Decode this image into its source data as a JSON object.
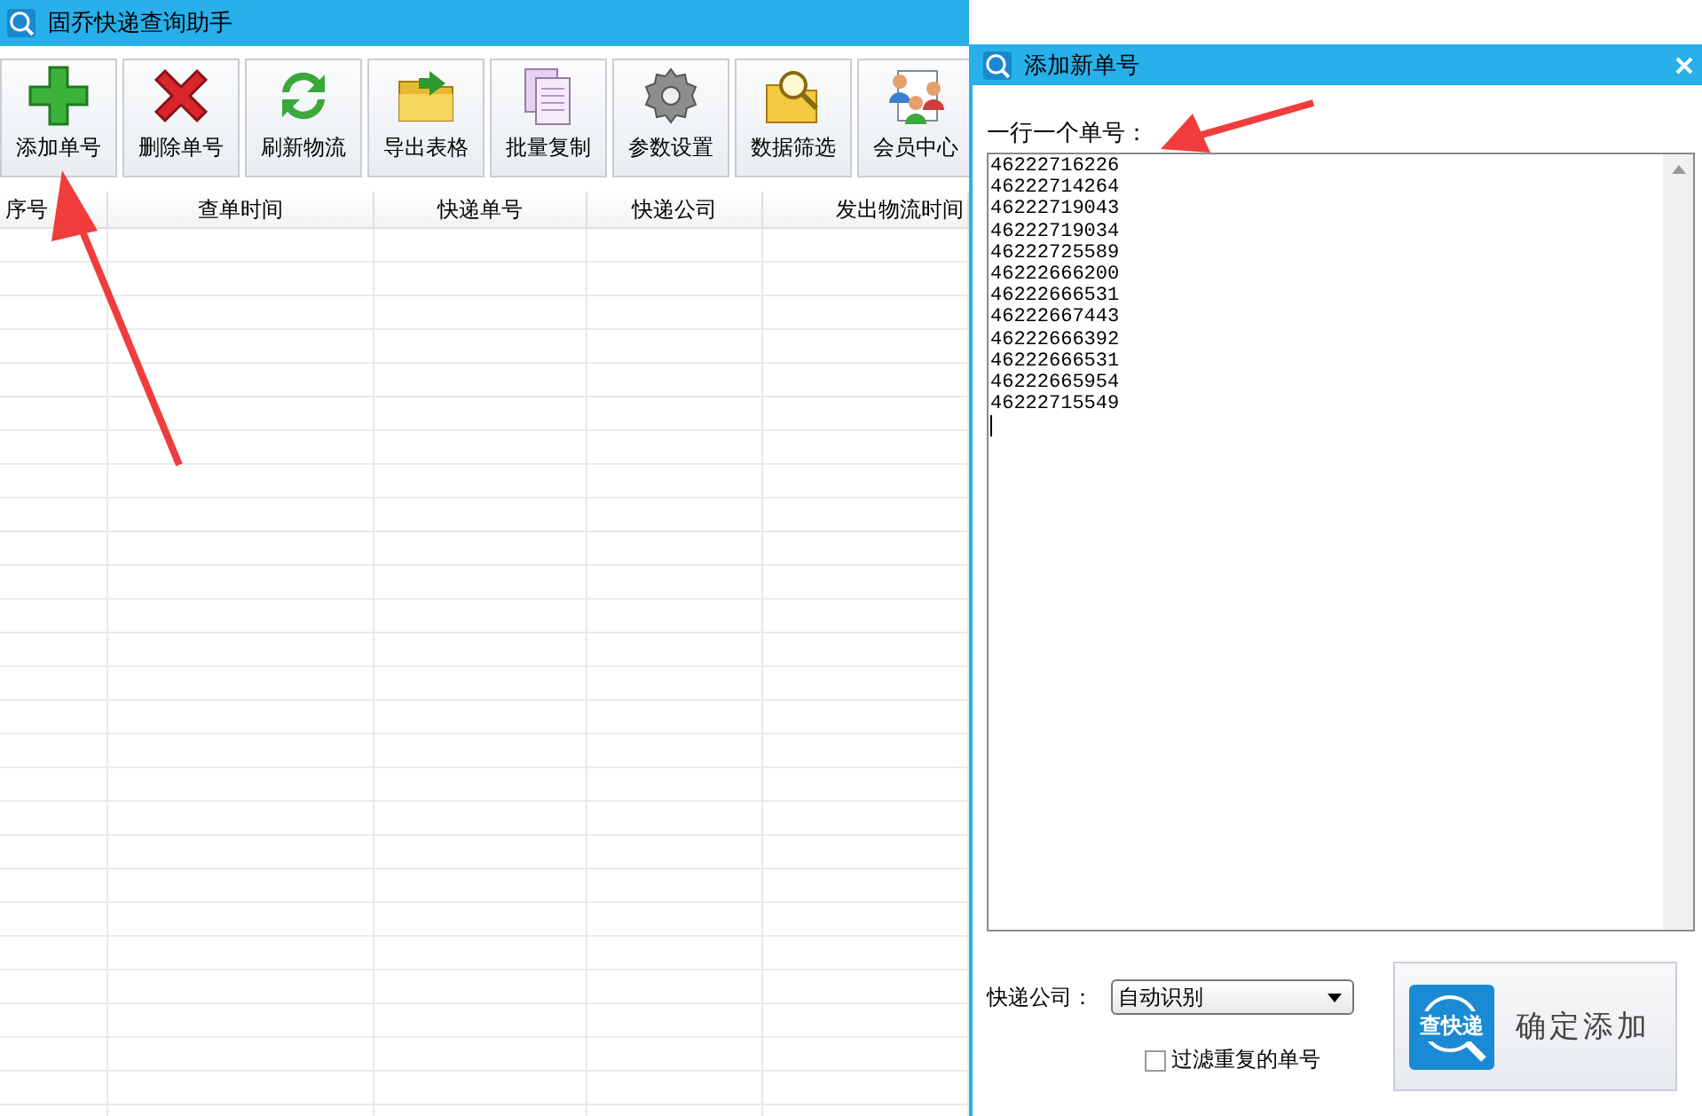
{
  "window": {
    "title": "固乔快递查询助手"
  },
  "toolbar": [
    {
      "label": "添加单号"
    },
    {
      "label": "删除单号"
    },
    {
      "label": "刷新物流"
    },
    {
      "label": "导出表格"
    },
    {
      "label": "批量复制"
    },
    {
      "label": "参数设置"
    },
    {
      "label": "数据筛选"
    },
    {
      "label": "会员中心"
    }
  ],
  "table": {
    "columns": [
      "序号",
      "查单时间",
      "快递单号",
      "快递公司",
      "发出物流时间"
    ]
  },
  "dialog": {
    "title": "添加新单号",
    "label": "一行一个单号：",
    "numbers": [
      "46222716226",
      "46222714264",
      "46222719043",
      "46222719034",
      "46222725589",
      "46222666200",
      "46222666531",
      "46222667443",
      "46222666392",
      "46222666531",
      "46222665954",
      "46222715549"
    ],
    "company_label": "快递公司：",
    "company_value": "自动识别",
    "filter": {
      "label": "过滤重复的单号",
      "checked": false
    },
    "confirm": {
      "logo_text": "查快递",
      "label": "确定添加"
    }
  }
}
